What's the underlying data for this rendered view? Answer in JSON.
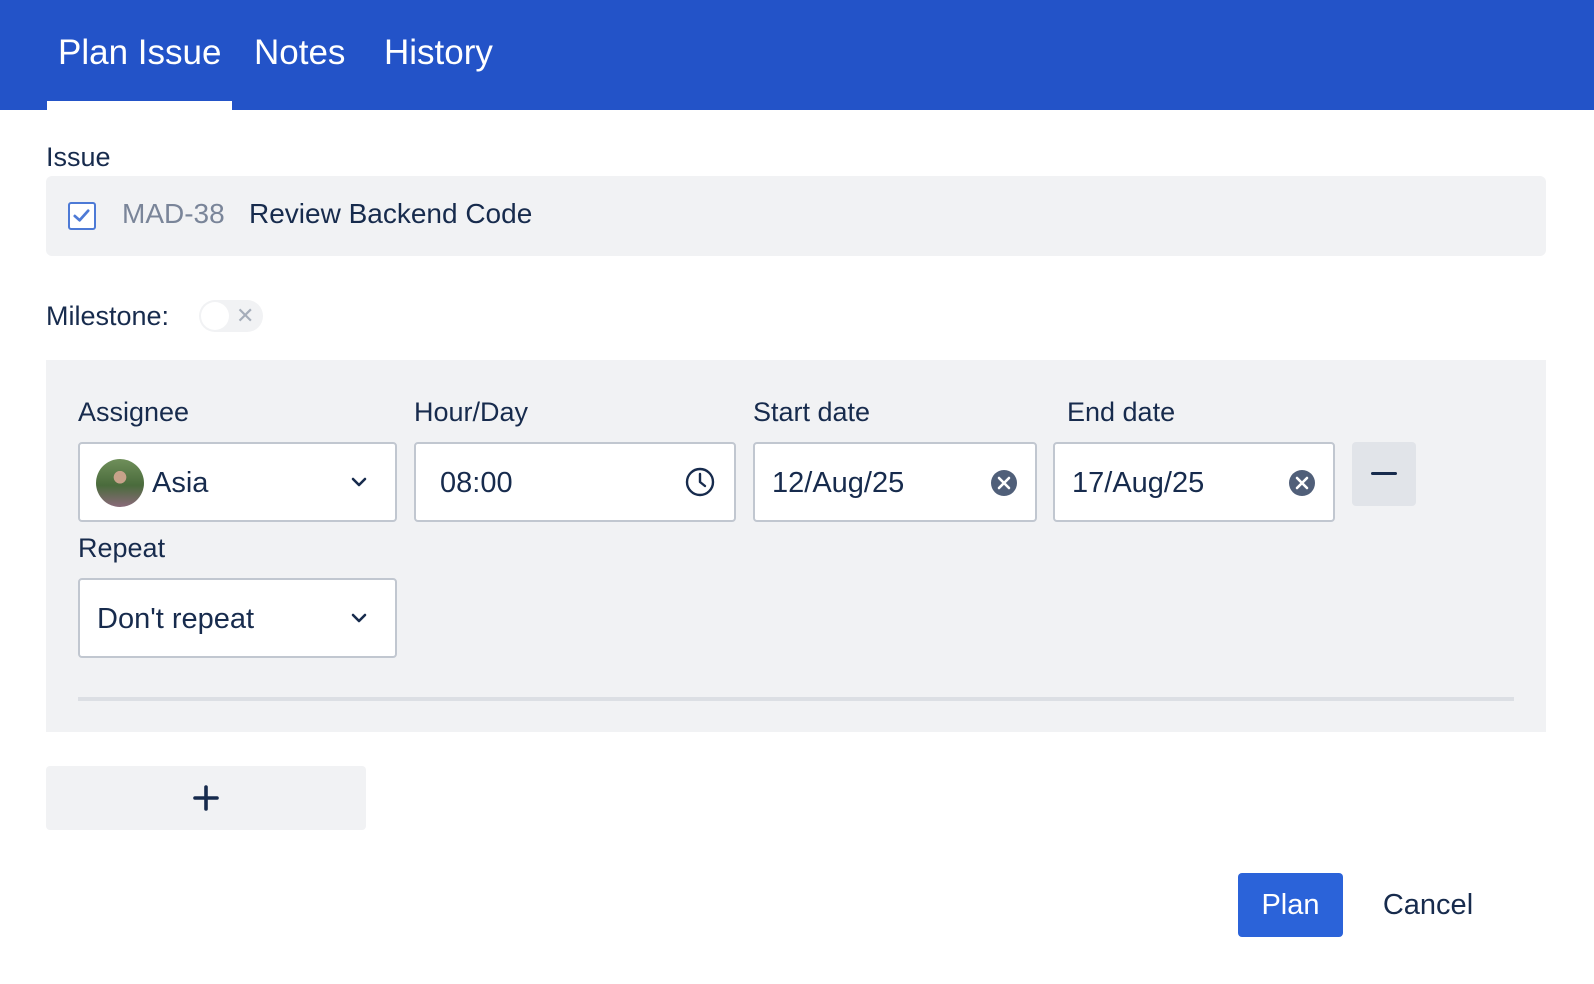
{
  "tabs": [
    {
      "label": "Plan Issue",
      "active": true
    },
    {
      "label": "Notes",
      "active": false
    },
    {
      "label": "History",
      "active": false
    }
  ],
  "issue": {
    "label": "Issue",
    "key": "MAD-38",
    "title": "Review Backend Code",
    "icon": "checkbox-icon"
  },
  "milestone": {
    "label": "Milestone:",
    "enabled": false
  },
  "assignment": {
    "assignee": {
      "label": "Assignee",
      "value": "Asia"
    },
    "hours": {
      "label": "Hour/Day",
      "value": "08:00"
    },
    "start_date": {
      "label": "Start date",
      "value": "12/Aug/25"
    },
    "end_date": {
      "label": "End date",
      "value": "17/Aug/25"
    },
    "repeat": {
      "label": "Repeat",
      "value": "Don't repeat"
    }
  },
  "actions": {
    "plan_label": "Plan",
    "cancel_label": "Cancel"
  },
  "colors": {
    "header": "#2353c8",
    "primary_button": "#2b63d9",
    "panel": "#f1f2f4"
  }
}
